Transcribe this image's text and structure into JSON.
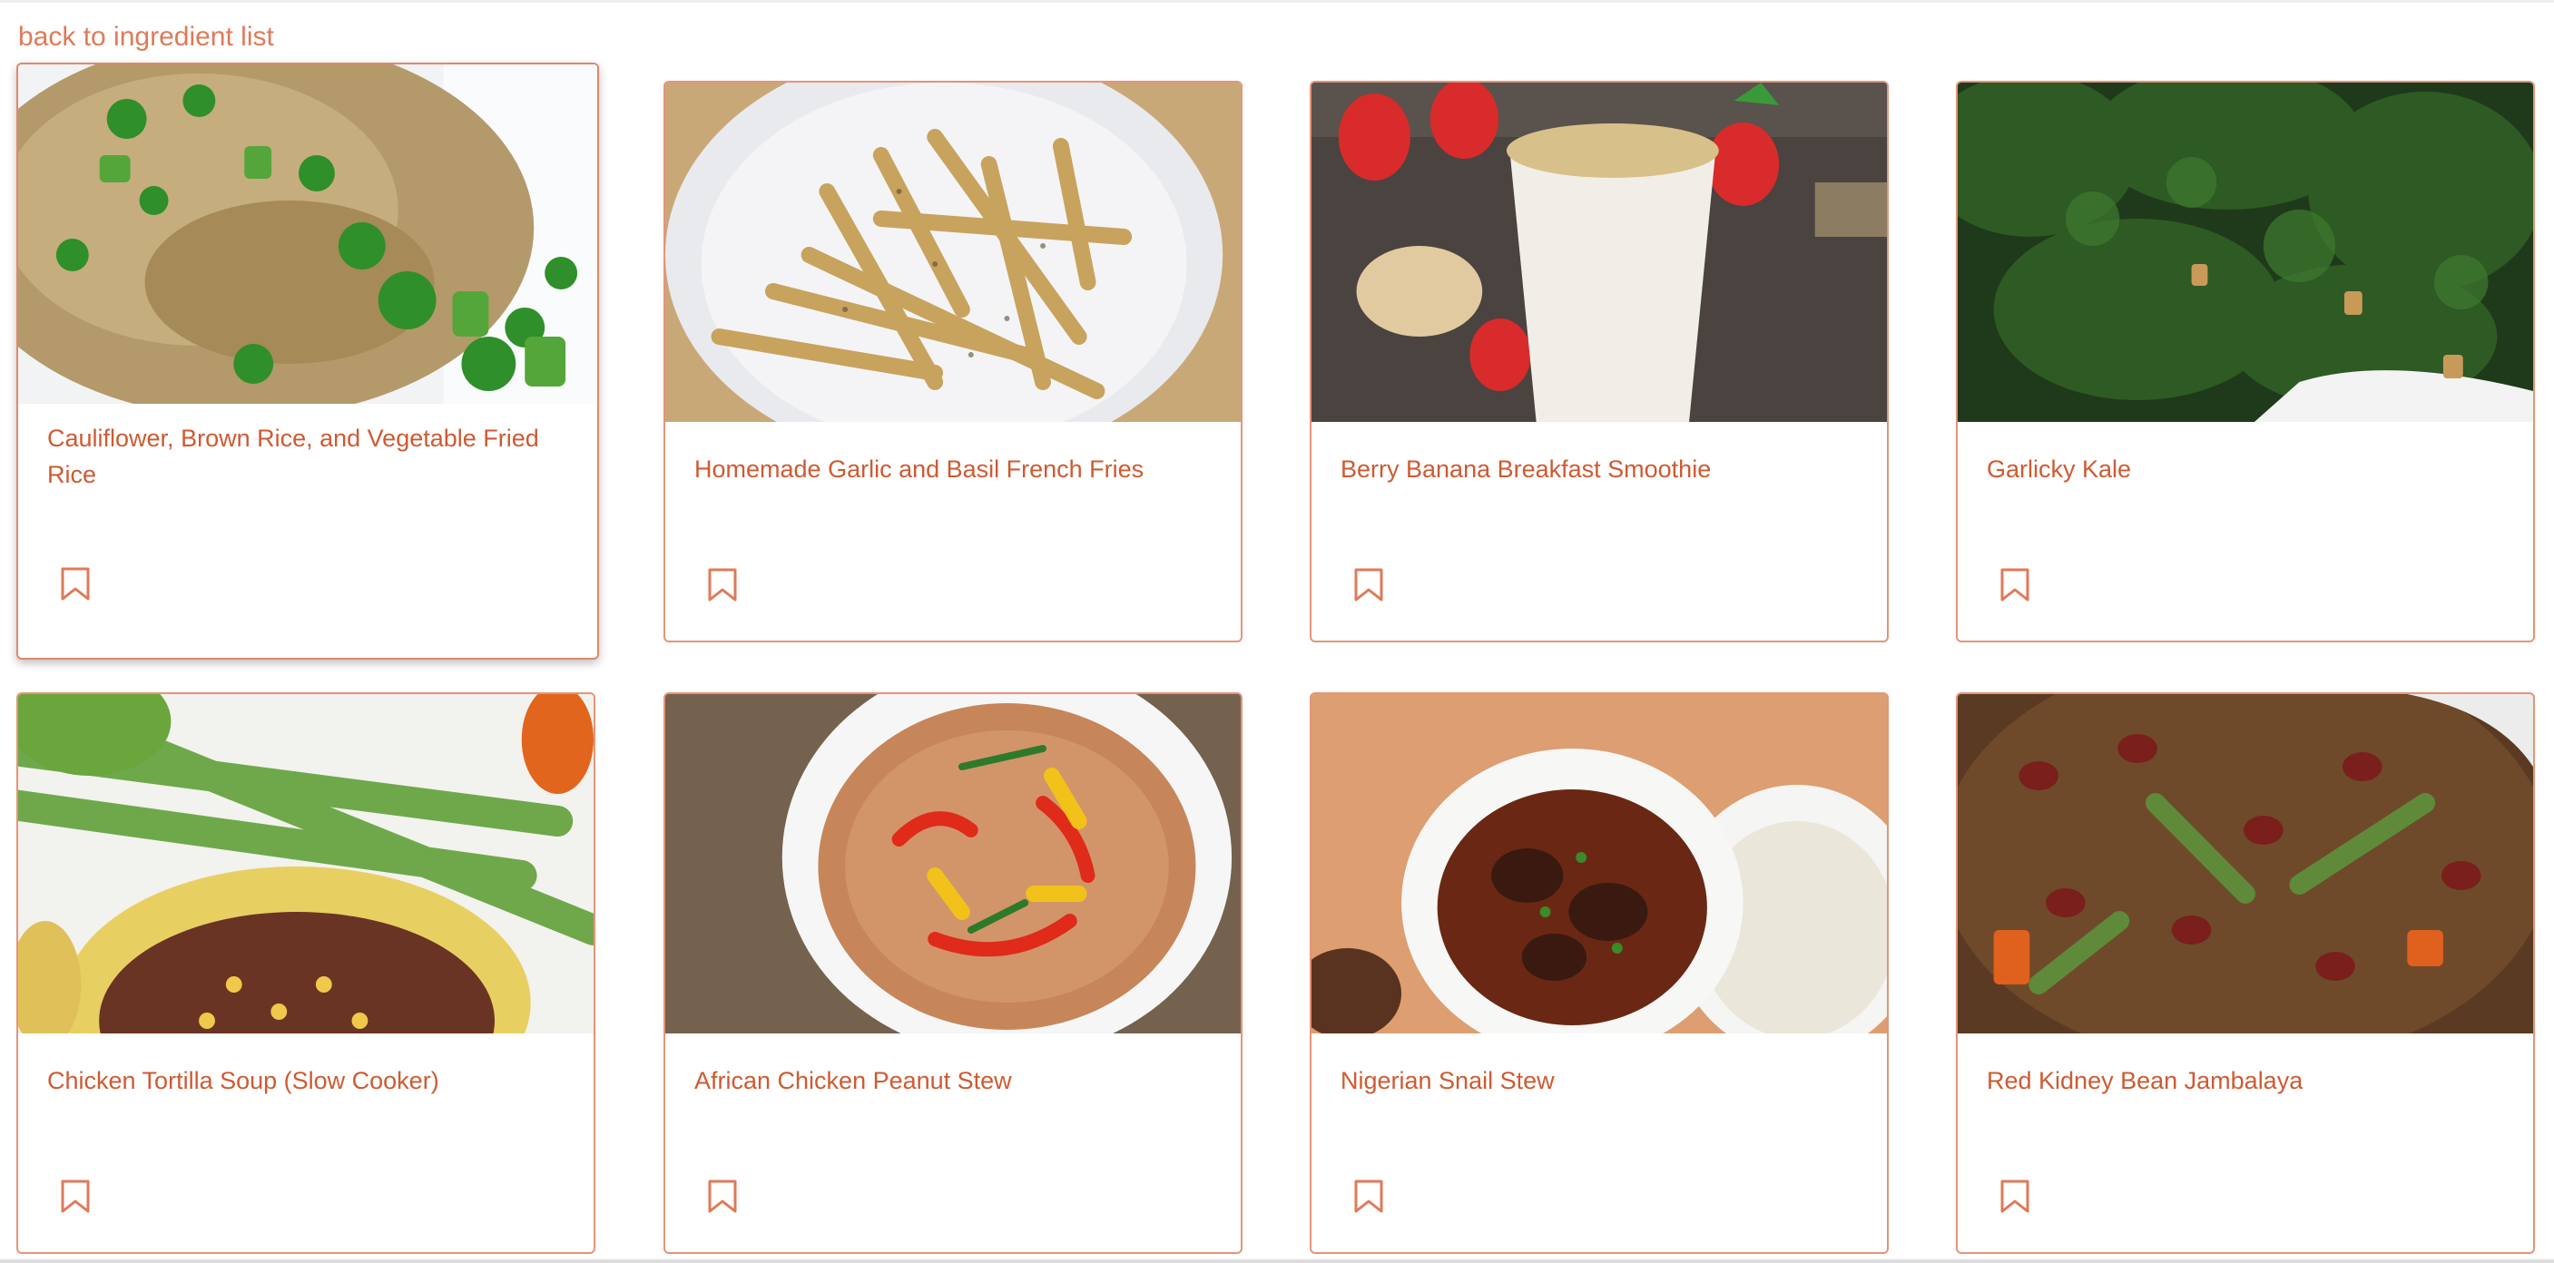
{
  "nav": {
    "back_label": "back to ingredient list"
  },
  "colors": {
    "accent": "#e07a58",
    "title": "#cf5a32",
    "border": "#e59478"
  },
  "cards": [
    {
      "title": "Cauliflower, Brown Rice, and Vegetable Fried Rice",
      "icon": "bookmark-icon"
    },
    {
      "title": "Homemade Garlic and Basil French Fries",
      "icon": "bookmark-icon"
    },
    {
      "title": "Berry Banana Breakfast Smoothie",
      "icon": "bookmark-icon"
    },
    {
      "title": "Garlicky Kale",
      "icon": "bookmark-icon"
    },
    {
      "title": "Chicken Tortilla Soup (Slow Cooker)",
      "icon": "bookmark-icon"
    },
    {
      "title": "African Chicken Peanut Stew",
      "icon": "bookmark-icon"
    },
    {
      "title": "Nigerian Snail Stew",
      "icon": "bookmark-icon"
    },
    {
      "title": "Red Kidney Bean Jambalaya",
      "icon": "bookmark-icon"
    }
  ]
}
